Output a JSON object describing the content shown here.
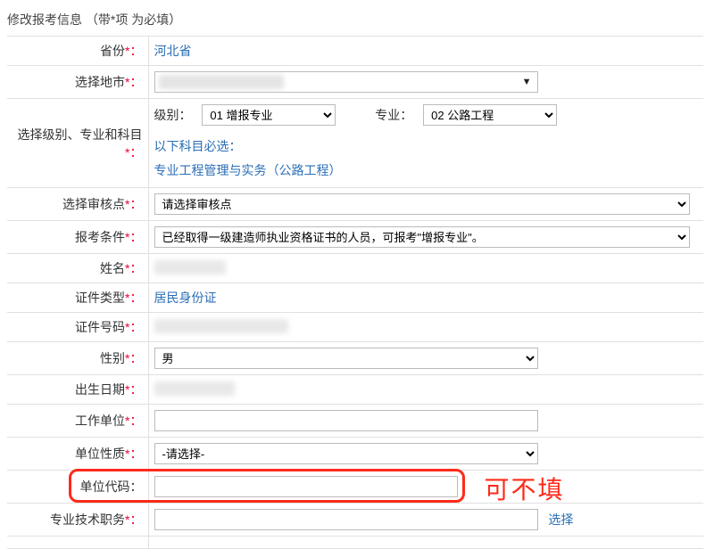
{
  "page": {
    "title": "修改报考信息 （带*项 为必填）"
  },
  "labels": {
    "province": "省份",
    "city": "选择地市",
    "level_group": "选择级别、专业和科目",
    "level": "级别：",
    "major": "专业：",
    "subject_hint_title": "以下科目必选：",
    "subject_hint_item": "专业工程管理与实务（公路工程）",
    "audit_point": "选择审核点",
    "conditions": "报考条件",
    "name": "姓名",
    "id_type": "证件类型",
    "id_no": "证件号码",
    "gender": "性别",
    "birthdate": "出生日期",
    "work_unit": "工作单位",
    "unit_nature": "单位性质",
    "unit_code": "单位代码：",
    "tech_title": "专业技术职务",
    "select_link": "选择"
  },
  "required_mark": "*：",
  "values": {
    "province": "河北省",
    "city": "（已隐去）",
    "level_selected": "01 增报专业",
    "major_selected": "02 公路工程",
    "audit_point_placeholder": "请选择审核点",
    "conditions_selected": "已经取得一级建造师执业资格证书的人员，可报考\"增报专业\"。",
    "name": "（已隐去）",
    "id_type": "居民身份证",
    "id_no": "（已隐去）",
    "gender_selected": "男",
    "birthdate": "（已隐去）",
    "work_unit": "",
    "unit_nature_selected": "-请选择-",
    "unit_code": "",
    "tech_title": ""
  },
  "options": {
    "level": [
      "01 增报专业"
    ],
    "major": [
      "02 公路工程"
    ],
    "gender": [
      "男"
    ],
    "unit_nature": [
      "-请选择-"
    ]
  },
  "annotation": {
    "text": "可不填"
  }
}
